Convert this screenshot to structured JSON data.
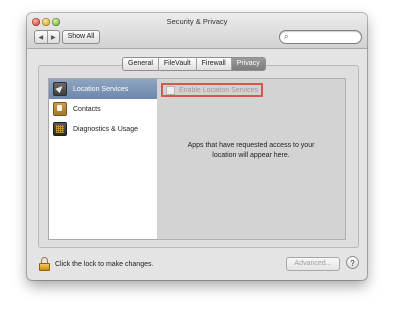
{
  "window": {
    "title": "Security & Privacy"
  },
  "toolbar": {
    "back_icon": "◀",
    "forward_icon": "▶",
    "show_all_label": "Show All",
    "search": {
      "value": "",
      "placeholder": "",
      "icon": "🔍"
    }
  },
  "tabs": [
    {
      "label": "General",
      "active": false
    },
    {
      "label": "FileVault",
      "active": false
    },
    {
      "label": "Firewall",
      "active": false
    },
    {
      "label": "Privacy",
      "active": true
    }
  ],
  "services": [
    {
      "label": "Location Services",
      "icon": "location-arrow-icon",
      "selected": true
    },
    {
      "label": "Contacts",
      "icon": "contacts-book-icon",
      "selected": false
    },
    {
      "label": "Diagnostics & Usage",
      "icon": "diagnostics-grid-icon",
      "selected": false
    }
  ],
  "detail": {
    "enable_label": "Enable Location Services",
    "enable_checked": false,
    "message_line1": "Apps that have requested access to your",
    "message_line2": "location will appear here."
  },
  "footer": {
    "lock_text": "Click the lock to make changes.",
    "advanced_label": "Advanced...",
    "help_label": "?"
  },
  "colors": {
    "selection": "#7a92b5",
    "highlight_border": "#d4594b"
  }
}
